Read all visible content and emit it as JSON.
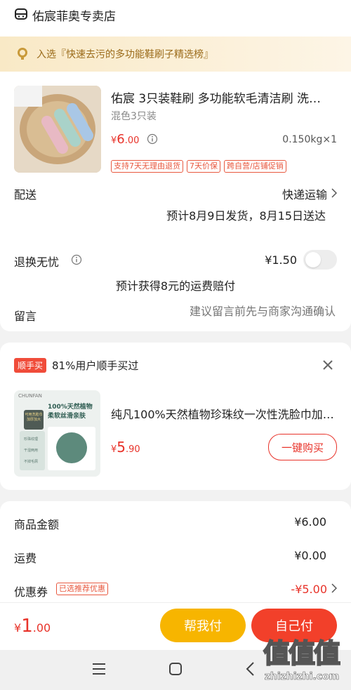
{
  "store": {
    "name": "佑宸菲奥专卖店"
  },
  "banner": {
    "text": "入选『快速去污的多功能鞋刷子精选榜』"
  },
  "product": {
    "title": "佑宸 3只装鞋刷 多功能软毛清洁刷 洗…",
    "variant": "混色3只装",
    "price_symbol": "¥",
    "price_int": "6",
    "price_dec": ".00",
    "weight_qty": "0.150kg×1",
    "tags": [
      "支持7天无理由退货",
      "7天价保",
      "跨自营/店铺促销"
    ]
  },
  "delivery": {
    "label": "配送",
    "method": "快递运输",
    "estimate": "预计8月9日发货，8月15日送达"
  },
  "returns": {
    "label": "退换无忧",
    "price": "¥1.50",
    "note": "预计获得8元的运费赔付",
    "toggle_on": false
  },
  "message": {
    "label": "留言",
    "placeholder": "建议留言前先与商家沟通确认"
  },
  "upsell": {
    "badge": "顺手买",
    "headline": "81%用户顺手买过",
    "item_title": "纯凡100%天然植物珍珠纹一次性洗脸巾加…",
    "price_symbol": "¥",
    "price_int": "5",
    "price_dec": ".90",
    "buy_label": "一键购买",
    "thumb_brand": "CHUNFAN",
    "thumb_line1": "100%天然植物",
    "thumb_line2": "柔软丝滑亲肤",
    "thumb_sticker": "可用洗脸巾 加厚加大",
    "thumb_bullets": [
      "珍珠纹理",
      "干湿两用",
      "不掉毛屑"
    ]
  },
  "summary": {
    "subtotal_label": "商品金额",
    "subtotal_value": "¥6.00",
    "shipping_label": "运费",
    "shipping_value": "¥0.00",
    "coupon_label": "优惠券",
    "coupon_tag": "已选推荐优惠",
    "coupon_value": "-¥5.00"
  },
  "footer": {
    "total_symbol": "¥",
    "total_int": "1",
    "total_dec": ".00",
    "help_pay_label": "帮我付",
    "self_pay_label": "自己付",
    "watermark_text": "值值值",
    "watermark_url": "zhizhizhi.com"
  },
  "colors": {
    "accent_red": "#e8332a",
    "banner_bg": "#fbf0d8",
    "help_pay_yellow": "#f7b500",
    "self_pay_red": "#f2402a"
  },
  "icons": [
    "store-icon",
    "trophy-icon",
    "info-icon",
    "chevron-right-icon",
    "close-icon",
    "menu-icon",
    "home-square-icon",
    "back-icon"
  ]
}
